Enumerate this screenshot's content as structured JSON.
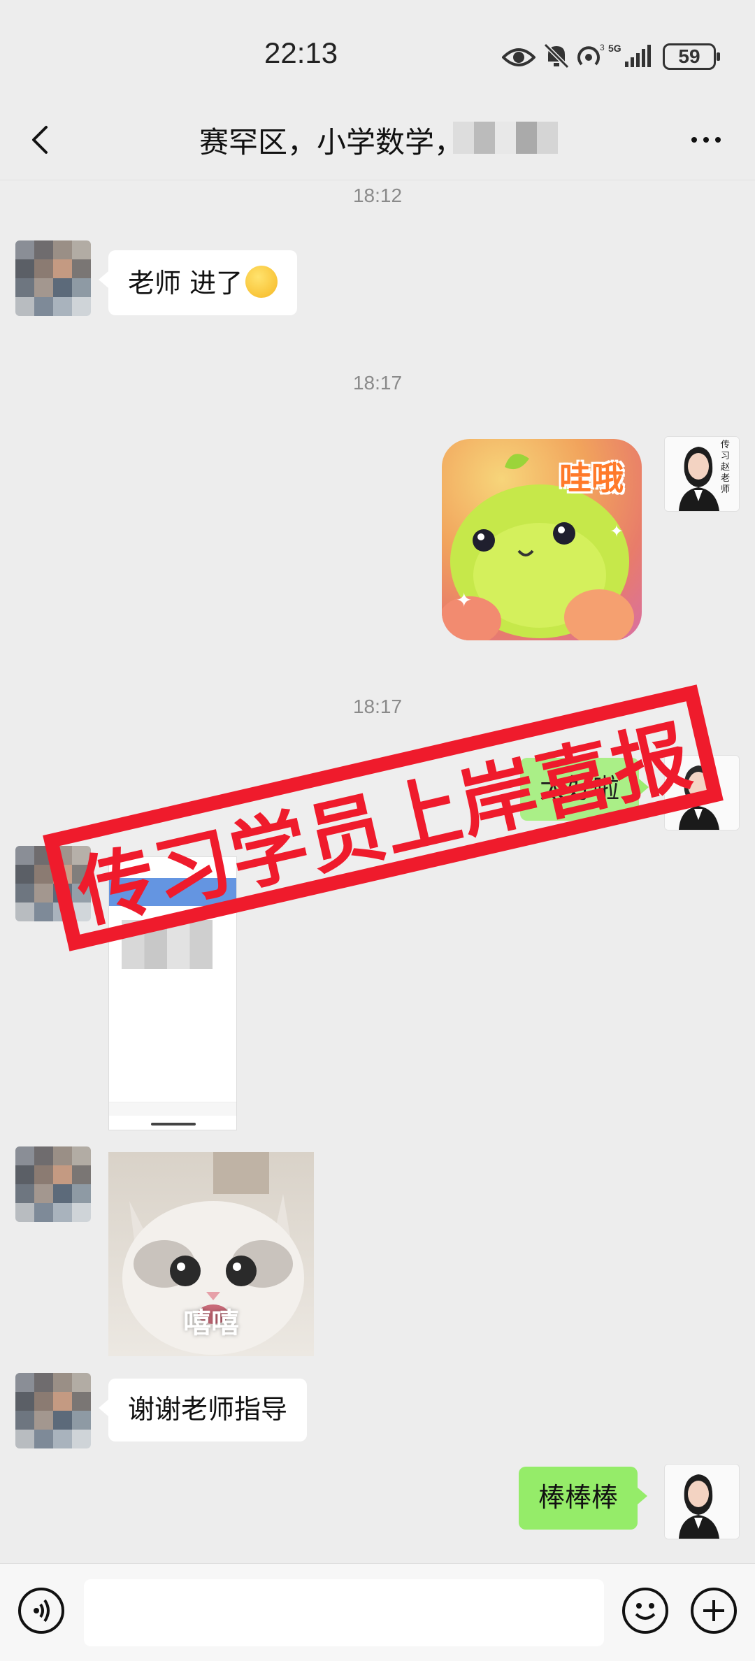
{
  "status_bar": {
    "time": "22:13",
    "battery": "59",
    "network": "5G"
  },
  "nav": {
    "title": "赛罕区，小学数学，"
  },
  "messages": {
    "t1": "18:12",
    "m1_text": "老师  进了",
    "t2": "18:17",
    "frog_sticker_text": "哇哦",
    "t3": "18:17",
    "m4_partial": "太好啦",
    "cat_sticker_text": "嘻嘻",
    "m6_text": "谢谢老师指导",
    "m7_text": "棒棒棒"
  },
  "stamp": {
    "text": "传习学员上岸喜报"
  },
  "teacher_avatar_text": "传习赵老师",
  "colors": {
    "background": "#ededed",
    "bubble_right": "#95ec69",
    "bubble_left": "#ffffff",
    "stamp_red": "#ef1b2c"
  },
  "icons": [
    "back-arrow-icon",
    "more-icon",
    "eye-icon",
    "mute-bell-icon",
    "hotspot-icon",
    "signal-icon",
    "battery-icon",
    "voice-icon",
    "emoji-icon",
    "plus-icon"
  ]
}
